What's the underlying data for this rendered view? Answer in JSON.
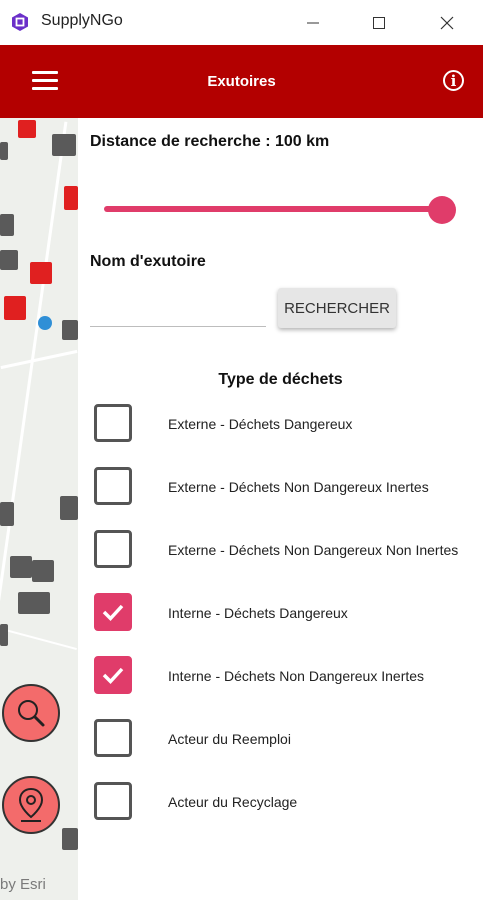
{
  "window": {
    "title": "SupplyNGo",
    "minimize_icon": "minimize-icon",
    "maximize_icon": "maximize-icon",
    "close_icon": "close-icon"
  },
  "header": {
    "title": "Exutoires",
    "menu_icon": "hamburger-menu-icon",
    "info_icon": "info-icon",
    "info_glyph": "i",
    "color": "#b30000"
  },
  "map": {
    "attribution": "by Esri",
    "search_icon": "magnifier-icon",
    "location_icon": "location-pin-icon"
  },
  "panel": {
    "distance_label": "Distance de recherche : 100 km",
    "distance_value_km": 100,
    "slider_fraction": 1.0,
    "name_label": "Nom d'exutoire",
    "name_value": "",
    "search_button": "RECHERCHER",
    "waste_type_title": "Type de déchets",
    "accent_color": "#e03c6a",
    "checkboxes": [
      {
        "label": "Externe - Déchets Dangereux",
        "checked": false
      },
      {
        "label": "Externe - Déchets Non Dangereux Inertes",
        "checked": false
      },
      {
        "label": "Externe - Déchets Non Dangereux Non Inertes",
        "checked": false
      },
      {
        "label": "Interne - Déchets Dangereux",
        "checked": true
      },
      {
        "label": "Interne - Déchets Non Dangereux Inertes",
        "checked": true
      },
      {
        "label": "Acteur du Reemploi",
        "checked": false
      },
      {
        "label": "Acteur du Recyclage",
        "checked": false
      }
    ]
  }
}
